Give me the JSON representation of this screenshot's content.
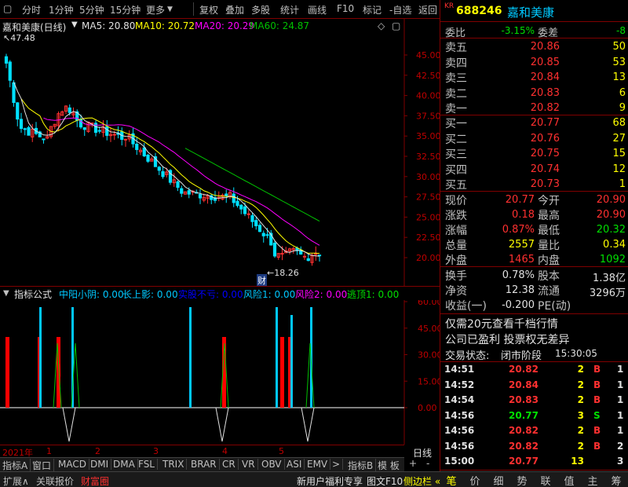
{
  "toolbar": {
    "left_items": [
      "分时",
      "1分钟",
      "5分钟",
      "15分钟",
      "更多"
    ],
    "right_items": [
      "复权",
      "叠加",
      "多股",
      "统计",
      "画线",
      "F10",
      "标记",
      "-自选",
      "返回"
    ]
  },
  "chart": {
    "title": "嘉和美康(日线)",
    "ma5": "MA5: 20.80",
    "ma10": "MA10: 20.72",
    "ma20": "MA20: 20.29",
    "ma60": "MA60: 24.87",
    "high_mark": "47.48",
    "low_mark": "18.26",
    "fin_mark": "财",
    "price_axis": [
      "45.00",
      "42.50",
      "40.00",
      "37.50",
      "35.00",
      "32.50",
      "30.00",
      "27.50",
      "25.00",
      "22.50",
      "20.00"
    ],
    "colors": {
      "ma5": "#e0e0e0",
      "ma10": "#ffff00",
      "ma20": "#ff00ff",
      "ma60": "#00c000",
      "up": "#ff3030",
      "down": "#00e0ff"
    }
  },
  "indicator": {
    "name": "指标公式",
    "items": [
      {
        "label": "中阳小阴: 0.00",
        "color": "#00c8ff"
      },
      {
        "label": "长上影: 0.00",
        "color": "#00c8ff"
      },
      {
        "label": "实股不亏: 0.00",
        "color": "#0000ff"
      },
      {
        "label": "风险1: 0.00",
        "color": "#00c8ff"
      },
      {
        "label": "风险2: 0.00",
        "color": "#ff00ff"
      },
      {
        "label": "逃顶1: 0.00",
        "color": "#00e000"
      }
    ],
    "axis": [
      "60.00",
      "45.00",
      "30.00",
      "15.00",
      "0.00"
    ]
  },
  "date_axis": {
    "year": "2021年",
    "months": [
      "1",
      "2",
      "3",
      "4",
      "5"
    ],
    "period": "日线"
  },
  "tabs": [
    "指标A",
    "窗口",
    "MACD",
    "DMI",
    "DMA",
    "FSL",
    "TRIX",
    "BRAR",
    "CR",
    "VR",
    "OBV",
    "ASI",
    "EMV",
    ">",
    "指标B",
    "模 板",
    "+",
    "-"
  ],
  "status_bar": {
    "expand": "扩展∧",
    "related": "关联报价",
    "wealth": "财富圈",
    "promo": "新用户福利专享",
    "f10": "图文F10",
    "sidebar": "侧边栏 «"
  },
  "panel": {
    "kr": "KR",
    "code": "688246",
    "name": "嘉和美康",
    "weibi_label": "委比",
    "weibi": "-3.15%",
    "weicha_label": "委差",
    "weicha": "-8",
    "asks": [
      {
        "label": "卖五",
        "price": "20.86",
        "vol": "50"
      },
      {
        "label": "卖四",
        "price": "20.85",
        "vol": "53"
      },
      {
        "label": "卖三",
        "price": "20.84",
        "vol": "13"
      },
      {
        "label": "卖二",
        "price": "20.83",
        "vol": "6"
      },
      {
        "label": "卖一",
        "price": "20.82",
        "vol": "9"
      }
    ],
    "bids": [
      {
        "label": "买一",
        "price": "20.77",
        "vol": "68"
      },
      {
        "label": "买二",
        "price": "20.76",
        "vol": "27"
      },
      {
        "label": "买三",
        "price": "20.75",
        "vol": "15"
      },
      {
        "label": "买四",
        "price": "20.74",
        "vol": "12"
      },
      {
        "label": "买五",
        "price": "20.73",
        "vol": "1"
      }
    ],
    "quote_rows": [
      {
        "l1": "现价",
        "v1": "20.77",
        "c1": "red",
        "l2": "今开",
        "v2": "20.90",
        "c2": "red"
      },
      {
        "l1": "涨跌",
        "v1": "0.18",
        "c1": "red",
        "l2": "最高",
        "v2": "20.90",
        "c2": "red"
      },
      {
        "l1": "涨幅",
        "v1": "0.87%",
        "c1": "red",
        "l2": "最低",
        "v2": "20.32",
        "c2": "green"
      },
      {
        "l1": "总量",
        "v1": "2557",
        "c1": "yellow",
        "l2": "量比",
        "v2": "0.34",
        "c2": "yellow"
      },
      {
        "l1": "外盘",
        "v1": "1465",
        "c1": "red",
        "l2": "内盘",
        "v2": "1092",
        "c2": "green"
      }
    ],
    "stat_rows": [
      {
        "l1": "换手",
        "v1": "0.78%",
        "l2": "股本",
        "v2": "1.38亿"
      },
      {
        "l1": "净资",
        "v1": "12.38",
        "l2": "流通",
        "v2": "3296万"
      },
      {
        "l1": "收益(一)",
        "v1": "-0.200",
        "l2": "PE(动)",
        "v2": ""
      }
    ],
    "notice1": "仅需20元查看千档行情",
    "notice2": "公司已盈利 投票权无差异",
    "trade_status_label": "交易状态:",
    "trade_status": "闭市阶段",
    "trade_time": "15:30:05",
    "ticks": [
      {
        "time": "14:51",
        "price": "20.82",
        "vol": "2",
        "bs": "B",
        "n": "1"
      },
      {
        "time": "14:52",
        "price": "20.84",
        "vol": "2",
        "bs": "B",
        "n": "1"
      },
      {
        "time": "14:54",
        "price": "20.83",
        "vol": "2",
        "bs": "B",
        "n": "1"
      },
      {
        "time": "14:56",
        "price": "20.77",
        "vol": "3",
        "bs": "S",
        "n": "1"
      },
      {
        "time": "14:56",
        "price": "20.82",
        "vol": "2",
        "bs": "B",
        "n": "1"
      },
      {
        "time": "14:56",
        "price": "20.82",
        "vol": "2",
        "bs": "B",
        "n": "2"
      },
      {
        "time": "15:00",
        "price": "20.77",
        "vol": "13",
        "bs": "",
        "n": "3"
      }
    ],
    "bottom_tabs": [
      "笔",
      "价",
      "细",
      "势",
      "联",
      "值",
      "主",
      "筹"
    ]
  }
}
